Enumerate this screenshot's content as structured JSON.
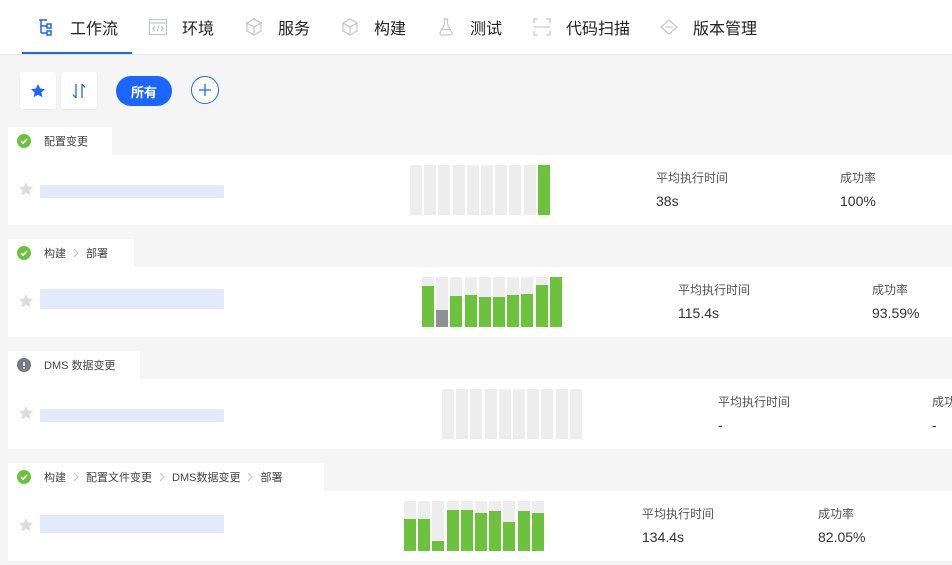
{
  "nav": {
    "tabs": [
      {
        "label": "工作流",
        "icon": "workflow-icon",
        "active": true
      },
      {
        "label": "环境",
        "icon": "code-window-icon",
        "active": false
      },
      {
        "label": "服务",
        "icon": "service-cube-icon",
        "active": false
      },
      {
        "label": "构建",
        "icon": "build-cube-icon",
        "active": false
      },
      {
        "label": "测试",
        "icon": "flask-icon",
        "active": false
      },
      {
        "label": "代码扫描",
        "icon": "scan-icon",
        "active": false
      },
      {
        "label": "版本管理",
        "icon": "version-diamond-icon",
        "active": false
      }
    ],
    "accent": "#1a66ff"
  },
  "toolbar": {
    "star_icon": "star-icon",
    "sort_icon": "sort-icon",
    "filter_label": "所有",
    "add_icon": "plus-icon"
  },
  "labels": {
    "avg_time": "平均执行时间",
    "success_rate": "成功率"
  },
  "colors": {
    "success": "#6cc13d",
    "warning": "#777a80",
    "run_success": "#6cc13d",
    "run_failed": "#8f8f94",
    "run_empty": "#ededee"
  },
  "workflows": [
    {
      "status": "success",
      "stages": [
        "配置变更"
      ],
      "runs": [
        0,
        0,
        0,
        0,
        0,
        0,
        0,
        0,
        0,
        1.0
      ],
      "failed": [],
      "avg_time_value": "38s",
      "success_rate_value": "100%"
    },
    {
      "status": "success",
      "stages": [
        "构建",
        "部署"
      ],
      "runs": [
        0.82,
        0.34,
        0.62,
        0.64,
        0.6,
        0.6,
        0.64,
        0.66,
        0.84,
        1.0
      ],
      "failed": [
        1
      ],
      "avg_time_value": "115.4s",
      "success_rate_value": "93.59%"
    },
    {
      "status": "warning",
      "stages": [
        "DMS 数据变更"
      ],
      "runs": [
        0,
        0,
        0,
        0,
        0,
        0,
        0,
        0,
        0,
        0
      ],
      "failed": [],
      "avg_time_value": "-",
      "success_rate_value": "-"
    },
    {
      "status": "success",
      "stages": [
        "构建",
        "配置文件变更",
        "DMS数据变更",
        "部署"
      ],
      "runs": [
        0.64,
        0.64,
        0.2,
        0.82,
        0.82,
        0.76,
        0.8,
        0.58,
        0.8,
        0.76
      ],
      "failed": [],
      "avg_time_value": "134.4s",
      "success_rate_value": "82.05%"
    }
  ]
}
